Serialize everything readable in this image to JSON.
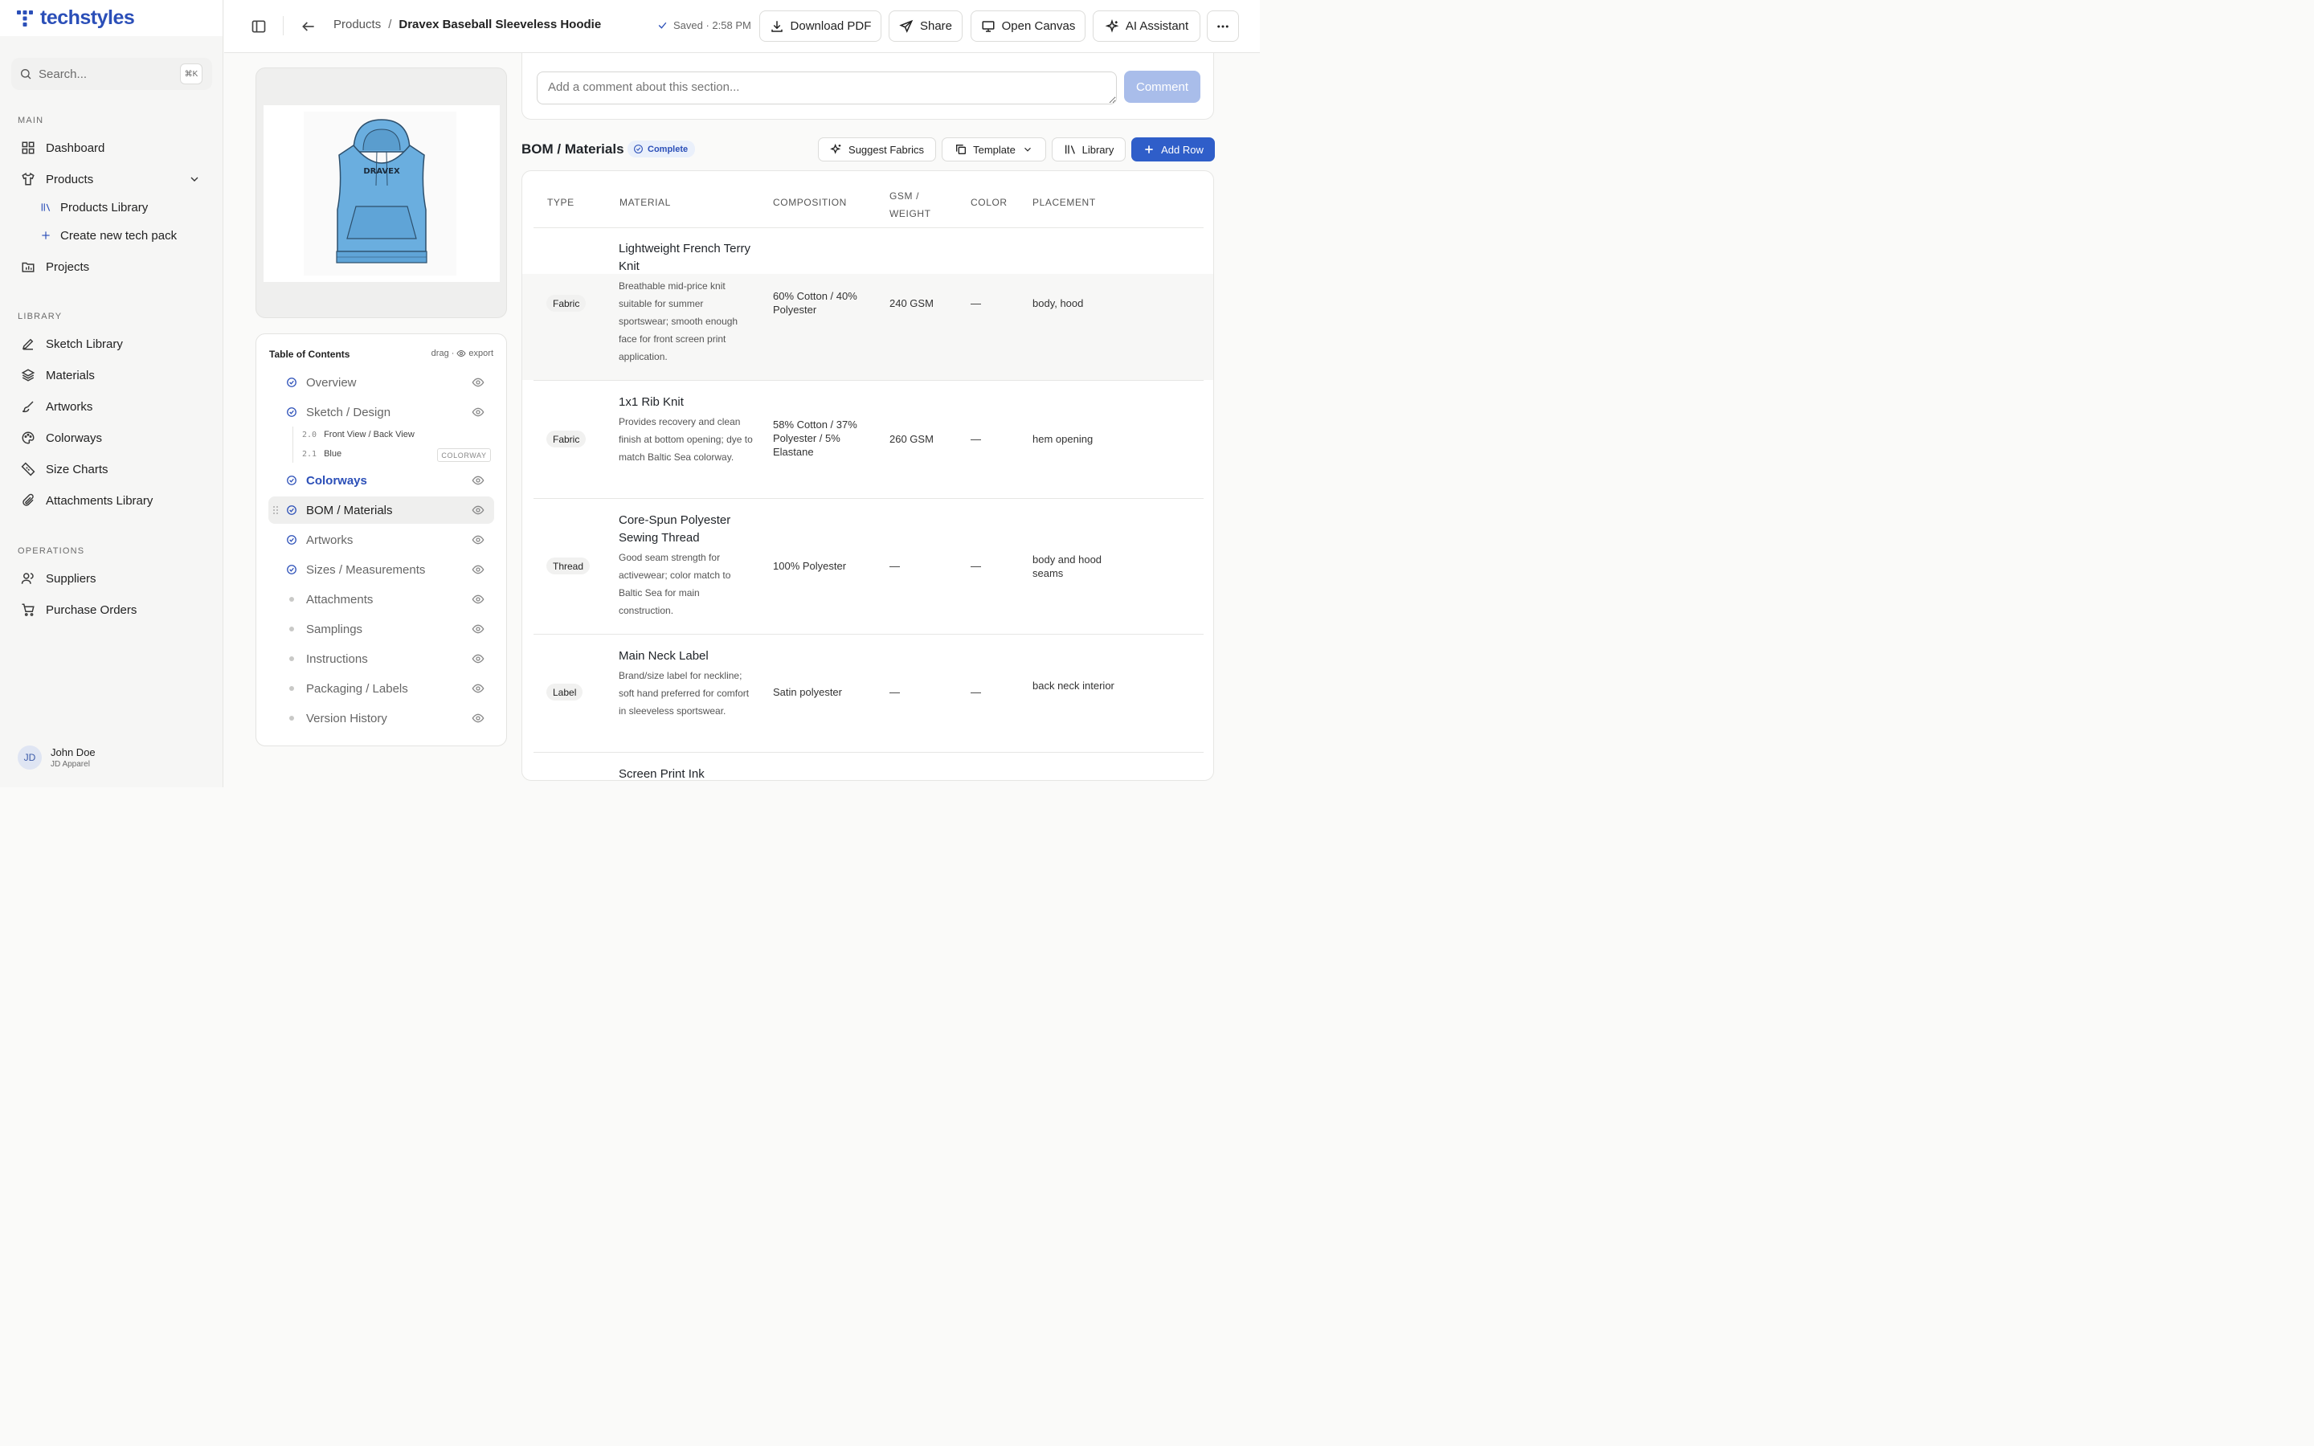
{
  "app": {
    "name": "techstyles",
    "brand_color": "#2b4fb8"
  },
  "sidebar": {
    "search_placeholder": "Search...",
    "search_shortcut": "⌘K",
    "main_label": "MAIN",
    "main_items": [
      {
        "label": "Dashboard",
        "icon": "grid-icon"
      },
      {
        "label": "Products",
        "icon": "shirt-icon"
      },
      {
        "label": "Projects",
        "icon": "folder-chart-icon"
      }
    ],
    "products_sub": [
      {
        "label": "Products Library",
        "icon": "library-icon"
      },
      {
        "label": "Create new tech pack",
        "icon": "plus-icon"
      }
    ],
    "library_label": "LIBRARY",
    "library_items": [
      {
        "label": "Sketch Library",
        "icon": "pen-icon"
      },
      {
        "label": "Materials",
        "icon": "layers-icon"
      },
      {
        "label": "Artworks",
        "icon": "brush-icon"
      },
      {
        "label": "Colorways",
        "icon": "palette-icon"
      },
      {
        "label": "Size Charts",
        "icon": "ruler-icon"
      },
      {
        "label": "Attachments Library",
        "icon": "paperclip-icon"
      }
    ],
    "operations_label": "OPERATIONS",
    "operations_items": [
      {
        "label": "Suppliers",
        "icon": "users-icon"
      },
      {
        "label": "Purchase Orders",
        "icon": "cart-icon"
      }
    ],
    "user": {
      "initials": "JD",
      "name": "John Doe",
      "org": "JD Apparel"
    }
  },
  "topbar": {
    "breadcrumb_parent": "Products",
    "breadcrumb_sep": "/",
    "breadcrumb_current": "Dravex Baseball Sleeveless Hoodie",
    "saved_status": "Saved · 2:58 PM",
    "download_label": "Download PDF",
    "share_label": "Share",
    "canvas_label": "Open Canvas",
    "ai_label": "AI Assistant"
  },
  "preview": {
    "logo_text": "DRAVEX",
    "garment_color": "#6aaedf"
  },
  "toc": {
    "title": "Table of Contents",
    "meta_drag": "drag ·",
    "meta_export": "export",
    "items": [
      {
        "label": "Overview",
        "state": "complete"
      },
      {
        "label": "Sketch / Design",
        "state": "complete"
      },
      {
        "label": "Colorways",
        "state": "complete"
      },
      {
        "label": "BOM / Materials",
        "state": "complete"
      },
      {
        "label": "Artworks",
        "state": "complete"
      },
      {
        "label": "Sizes / Measurements",
        "state": "complete"
      },
      {
        "label": "Attachments",
        "state": "pending"
      },
      {
        "label": "Samplings",
        "state": "pending"
      },
      {
        "label": "Instructions",
        "state": "pending"
      },
      {
        "label": "Packaging / Labels",
        "state": "pending"
      },
      {
        "label": "Version History",
        "state": "pending"
      }
    ],
    "sub_items": [
      {
        "num": "2.0",
        "label": "Front View / Back View"
      },
      {
        "num": "2.1",
        "label": "Blue"
      }
    ],
    "colorway_tag": "COLORWAY"
  },
  "comment": {
    "placeholder": "Add a comment about this section...",
    "button": "Comment"
  },
  "bom": {
    "title": "BOM / Materials",
    "status": "Complete",
    "suggest_label": "Suggest Fabrics",
    "template_label": "Template",
    "library_label": "Library",
    "add_row_label": "Add Row",
    "columns": {
      "type": "TYPE",
      "material": "MATERIAL",
      "composition": "COMPOSITION",
      "gsm_1": "GSM /",
      "gsm_2": "WEIGHT",
      "color": "COLOR",
      "placement": "PLACEMENT"
    },
    "rows": [
      {
        "type": "Fabric",
        "name": "Lightweight French Terry Knit",
        "desc": "Breathable mid-price knit suitable for summer sportswear; smooth enough face for front screen print application.",
        "composition": "60% Cotton / 40% Polyester",
        "gsm": "240 GSM",
        "color": "—",
        "placement": "body, hood"
      },
      {
        "type": "Fabric",
        "name": "1x1 Rib Knit",
        "desc": "Provides recovery and clean finish at bottom opening; dye to match Baltic Sea colorway.",
        "composition": "58% Cotton / 37% Polyester / 5% Elastane",
        "gsm": "260 GSM",
        "color": "—",
        "placement": "hem opening"
      },
      {
        "type": "Thread",
        "name": "Core-Spun Polyester Sewing Thread",
        "desc": "Good seam strength for activewear; color match to Baltic Sea for main construction.",
        "composition": "100% Polyester",
        "gsm": "—",
        "color": "—",
        "placement": "body and hood seams"
      },
      {
        "type": "Label",
        "name": "Main Neck Label",
        "desc": "Brand/size label for neckline; soft hand preferred for comfort in sleeveless sportswear.",
        "composition": "Satin polyester",
        "gsm": "—",
        "color": "—",
        "placement": "back neck interior"
      },
      {
        "name": "Screen Print Ink"
      }
    ]
  }
}
